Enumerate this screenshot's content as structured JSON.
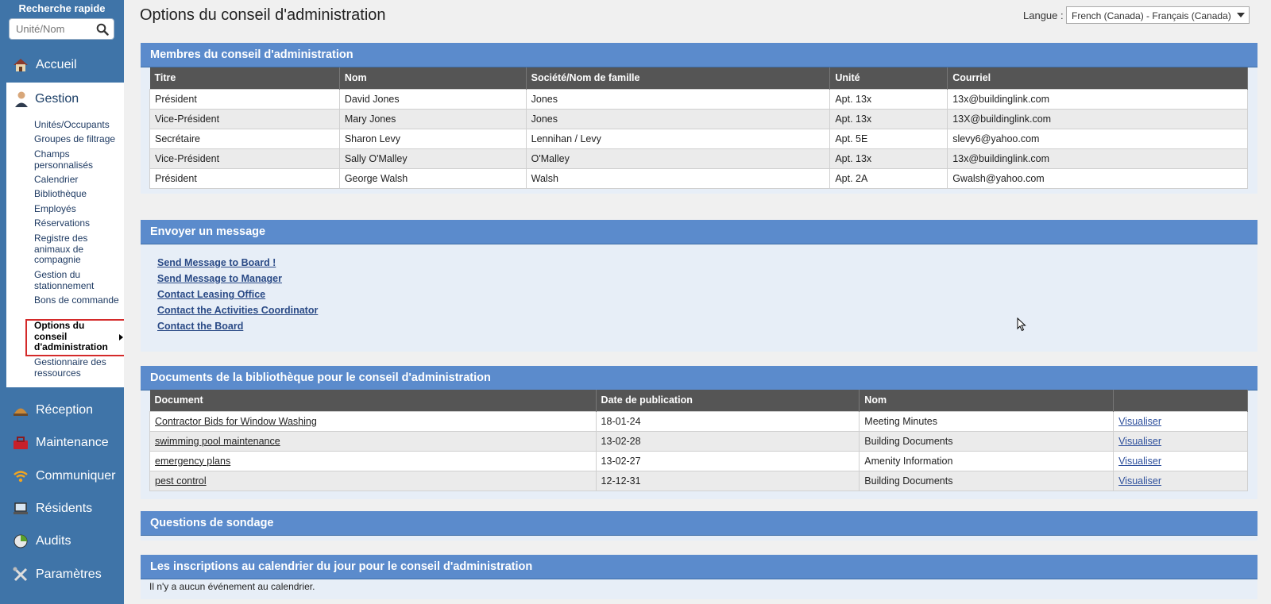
{
  "sidebar": {
    "quick_search_title": "Recherche rapide",
    "search_placeholder": "Unité/Nom",
    "main_items": [
      {
        "label": "Accueil",
        "icon": "house-icon"
      },
      {
        "label": "Gestion",
        "icon": "manager-person-icon"
      },
      {
        "label": "Réception",
        "icon": "desk-bell-icon"
      },
      {
        "label": "Maintenance",
        "icon": "toolbox-icon"
      },
      {
        "label": "Communiquer",
        "icon": "wifi-signal-icon"
      },
      {
        "label": "Résidents",
        "icon": "laptop-icon"
      },
      {
        "label": "Audits",
        "icon": "pie-chart-icon"
      },
      {
        "label": "Paramètres",
        "icon": "tools-icon"
      }
    ],
    "gestion_items": [
      "Unités/Occupants",
      "Groupes de filtrage",
      "Champs personnalisés",
      "Calendrier",
      "Bibliothèque",
      "Employés",
      "Réservations",
      "Registre des animaux de compagnie",
      "Gestion du stationnement",
      "Bons de commande",
      "Options du conseil d'administration",
      "Gestionnaire des ressources"
    ],
    "active_item": "Options du conseil d'administration"
  },
  "header": {
    "title": "Options du conseil d'administration",
    "language_label": "Langue :",
    "language_value": "French (Canada) - Français (Canada)"
  },
  "members": {
    "title": "Membres du conseil d'administration",
    "columns": [
      "Titre",
      "Nom",
      "Société/Nom de famille",
      "Unité",
      "Courriel"
    ],
    "rows": [
      [
        "Président",
        "David Jones",
        "Jones",
        "Apt. 13x",
        "13x@buildinglink.com"
      ],
      [
        "Vice-Président",
        "Mary Jones",
        "Jones",
        "Apt. 13x",
        "13X@buildinglink.com"
      ],
      [
        "Secrétaire",
        "Sharon Levy",
        "Lennihan / Levy",
        "Apt. 5E",
        "slevy6@yahoo.com"
      ],
      [
        "Vice-Président",
        "Sally O'Malley",
        "O'Malley",
        "Apt. 13x",
        "13x@buildinglink.com"
      ],
      [
        "Président",
        "George Walsh",
        "Walsh",
        "Apt. 2A",
        "Gwalsh@yahoo.com"
      ]
    ]
  },
  "message": {
    "title": "Envoyer un message",
    "links": [
      "Send Message to Board !",
      "Send Message to Manager",
      "Contact Leasing Office",
      "Contact the Activities Coordinator",
      "Contact the Board"
    ]
  },
  "documents": {
    "title": "Documents de la bibliothèque pour le conseil d'administration",
    "columns": [
      "Document",
      "Date de publication",
      "Nom",
      ""
    ],
    "rows": [
      {
        "document": "Contractor Bids for Window Washing",
        "date": "18-01-24",
        "name": "Meeting Minutes",
        "action": "Visualiser"
      },
      {
        "document": "swimming pool maintenance",
        "date": "13-02-28",
        "name": "Building Documents",
        "action": "Visualiser"
      },
      {
        "document": "emergency plans",
        "date": "13-02-27",
        "name": "Amenity Information",
        "action": "Visualiser"
      },
      {
        "document": "pest control",
        "date": "12-12-31",
        "name": "Building Documents",
        "action": "Visualiser"
      }
    ]
  },
  "survey": {
    "title": "Questions de sondage"
  },
  "calendar": {
    "title": "Les inscriptions au calendrier du jour pour le conseil d'administration",
    "empty_text": "Il n'y a aucun événement au calendrier."
  },
  "colors": {
    "sidebar_bg": "#3f74a8",
    "section_header": "#5b8bcc",
    "table_header": "#555555",
    "active_outline": "#d42a2a"
  }
}
